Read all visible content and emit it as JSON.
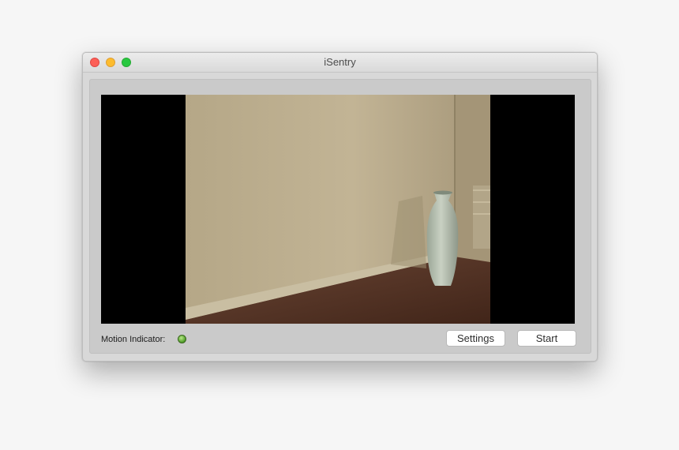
{
  "window": {
    "title": "iSentry"
  },
  "video": {
    "label": "camera-feed"
  },
  "footer": {
    "motion_label": "Motion Indicator:",
    "motion_state": "active",
    "settings_label": "Settings",
    "start_label": "Start"
  },
  "colors": {
    "led": "#6cc24a",
    "close": "#fc5f57",
    "minimize": "#fdbc2e",
    "maximize": "#28c840"
  }
}
